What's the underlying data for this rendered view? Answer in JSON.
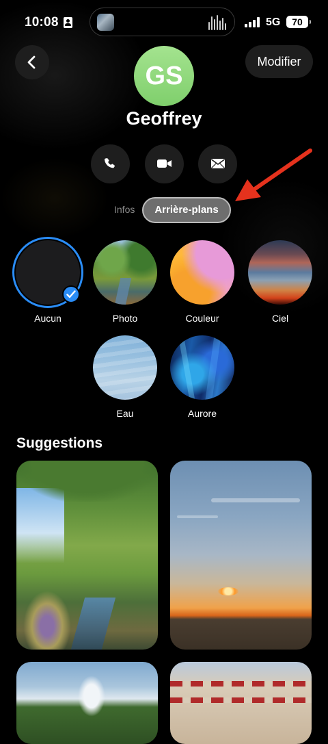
{
  "status_bar": {
    "time": "10:08",
    "network": "5G",
    "battery": "70"
  },
  "header": {
    "edit_label": "Modifier",
    "avatar_initials": "GS",
    "contact_name": "Geoffrey"
  },
  "segments": {
    "info": "Infos",
    "backgrounds": "Arrière-plans"
  },
  "backgrounds": [
    {
      "label": "Aucun",
      "selected": true
    },
    {
      "label": "Photo"
    },
    {
      "label": "Couleur"
    },
    {
      "label": "Ciel"
    },
    {
      "label": "Eau"
    },
    {
      "label": "Aurore"
    }
  ],
  "suggestions": {
    "title": "Suggestions"
  },
  "colors": {
    "accent": "#2a8cf5",
    "avatar": "#8fd97b",
    "annotation_arrow": "#e5321d"
  },
  "icons": [
    "back-chevron-icon",
    "phone-icon",
    "video-icon",
    "mail-icon",
    "checkmark-icon"
  ]
}
